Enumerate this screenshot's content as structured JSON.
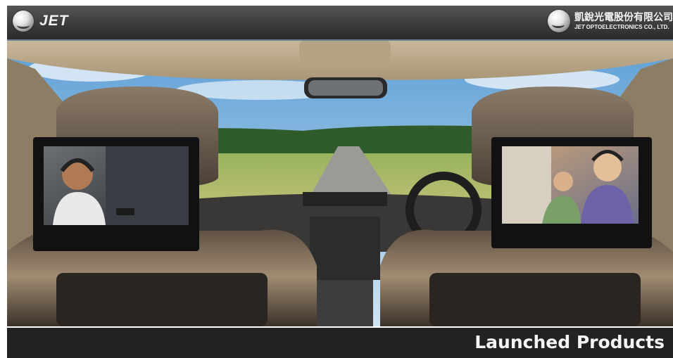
{
  "header": {
    "brand_left": "JET",
    "company_cn": "凱銳光電股份有限公司",
    "company_en_brand": "JET",
    "company_en": "OPTOELECTRONICS CO., LTD."
  },
  "footer": {
    "title": "Launched Products"
  },
  "colors": {
    "header_bg": "#3c3c3c",
    "header_rule": "#6f7f95",
    "footer_bg": "#222222",
    "text_light": "#f5f5f5"
  }
}
